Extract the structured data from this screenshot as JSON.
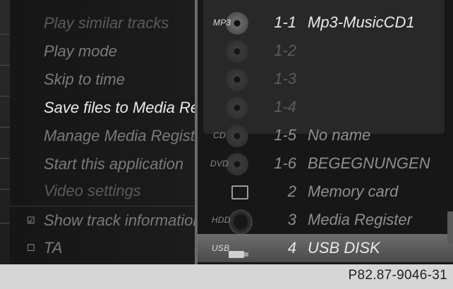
{
  "left_menu": {
    "items": [
      {
        "label": "Play similar tracks",
        "state": "dim"
      },
      {
        "label": "Play mode",
        "state": "normal"
      },
      {
        "label": "Skip to time",
        "state": "normal"
      },
      {
        "label": "Save files to Media Register",
        "state": "bright"
      },
      {
        "label": "Manage Media Register",
        "state": "normal"
      },
      {
        "label": "Start this application",
        "state": "normal"
      },
      {
        "label": "Video settings",
        "state": "dim"
      },
      {
        "label": "Show track information",
        "state": "normal",
        "checkbox": "checked"
      },
      {
        "label": "TA",
        "state": "normal",
        "checkbox": "unchecked"
      }
    ]
  },
  "media_list": {
    "rows": [
      {
        "icon": "mp3-disc-icon",
        "icon_label": "MP3",
        "number": "1-1",
        "name": "Mp3-MusicCD1",
        "state": "bright"
      },
      {
        "icon": "disc-icon",
        "icon_label": "",
        "number": "1-2",
        "name": "",
        "state": "dim"
      },
      {
        "icon": "disc-icon",
        "icon_label": "",
        "number": "1-3",
        "name": "",
        "state": "dim"
      },
      {
        "icon": "disc-icon",
        "icon_label": "",
        "number": "1-4",
        "name": "",
        "state": "dim"
      },
      {
        "icon": "cd-disc-icon",
        "icon_label": "CD",
        "number": "1-5",
        "name": "No name",
        "state": "normal"
      },
      {
        "icon": "dvd-disc-icon",
        "icon_label": "DVD",
        "number": "1-6",
        "name": "BEGEGNUNGEN",
        "state": "normal"
      },
      {
        "icon": "memory-card-icon",
        "icon_label": "",
        "number": "2",
        "name": "Memory card",
        "state": "normal"
      },
      {
        "icon": "hdd-icon",
        "icon_label": "HDD",
        "number": "3",
        "name": "Media Register",
        "state": "normal"
      },
      {
        "icon": "usb-icon",
        "icon_label": "USB",
        "number": "4",
        "name": "USB DISK",
        "state": "selected"
      }
    ]
  },
  "footer": {
    "code": "P82.87-9046-31"
  },
  "colors": {
    "background": "#111111",
    "text_bright": "#e8e8e8",
    "text_normal": "#8e8e8e",
    "selected_bar": "#5c5c5c"
  }
}
